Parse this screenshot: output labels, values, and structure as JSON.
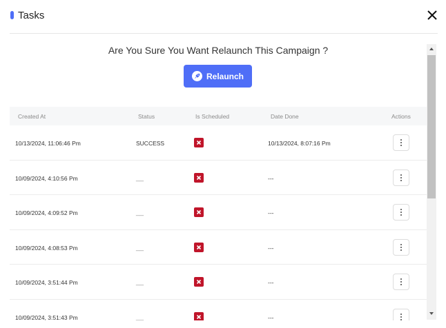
{
  "header": {
    "title": "Tasks",
    "accent_color": "#4f6ef7"
  },
  "confirm": {
    "question": "Are You Sure You Want Relaunch This Campaign ?",
    "relaunch_label": "Relaunch",
    "relaunch_icon": "rocket-icon",
    "button_color": "#4f6ef7"
  },
  "table": {
    "columns": [
      "Created At",
      "Status",
      "Is Scheduled",
      "Date Done",
      "Actions"
    ],
    "scheduled_false_color": "#c0152a",
    "rows": [
      {
        "created_at": "10/13/2024, 11:06:46 Pm",
        "status": "SUCCESS",
        "is_scheduled": false,
        "date_done": "10/13/2024, 8:07:16 Pm"
      },
      {
        "created_at": "10/09/2024, 4:10:56 Pm",
        "status": "__",
        "is_scheduled": false,
        "date_done": "---"
      },
      {
        "created_at": "10/09/2024, 4:09:52 Pm",
        "status": "__",
        "is_scheduled": false,
        "date_done": "---"
      },
      {
        "created_at": "10/09/2024, 4:08:53 Pm",
        "status": "__",
        "is_scheduled": false,
        "date_done": "---"
      },
      {
        "created_at": "10/09/2024, 3:51:44 Pm",
        "status": "__",
        "is_scheduled": false,
        "date_done": "---"
      },
      {
        "created_at": "10/09/2024, 3:51:43 Pm",
        "status": "__",
        "is_scheduled": false,
        "date_done": "---"
      }
    ]
  }
}
